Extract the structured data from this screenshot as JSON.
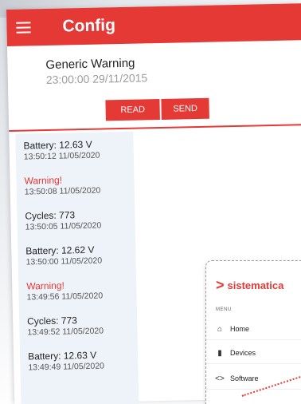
{
  "header": {
    "title": "Config",
    "menu_icon": "hamburger-menu-icon"
  },
  "warning": {
    "title": "Generic Warning",
    "timestamp": "23:00:00 29/11/2015"
  },
  "actions": {
    "read_label": "READ",
    "send_label": "SEND"
  },
  "log": [
    {
      "title": "Battery: 12.63 V",
      "time": "13:50:12 11/05/2020",
      "type": "normal"
    },
    {
      "title": "Warning!",
      "time": "13:50:08 11/05/2020",
      "type": "warning"
    },
    {
      "title": "Cycles: 773",
      "time": "13:50:05 11/05/2020",
      "type": "normal"
    },
    {
      "title": "Battery: 12.62 V",
      "time": "13:50:00 11/05/2020",
      "type": "normal"
    },
    {
      "title": "Warning!",
      "time": "13:49:56 11/05/2020",
      "type": "warning"
    },
    {
      "title": "Cycles: 773",
      "time": "13:49:52 11/05/2020",
      "type": "normal"
    },
    {
      "title": "Battery: 12.63 V",
      "time": "13:49:49 11/05/2020",
      "type": "normal"
    }
  ],
  "overlay": {
    "brand": "sistematica",
    "menu_label": "MENU",
    "items": [
      {
        "label": "Home",
        "icon": "home-icon"
      },
      {
        "label": "Devices",
        "icon": "device-icon"
      },
      {
        "label": "Software",
        "icon": "code-icon"
      }
    ]
  },
  "colors": {
    "accent": "#e53935",
    "log_bg": "#eef3f9"
  }
}
